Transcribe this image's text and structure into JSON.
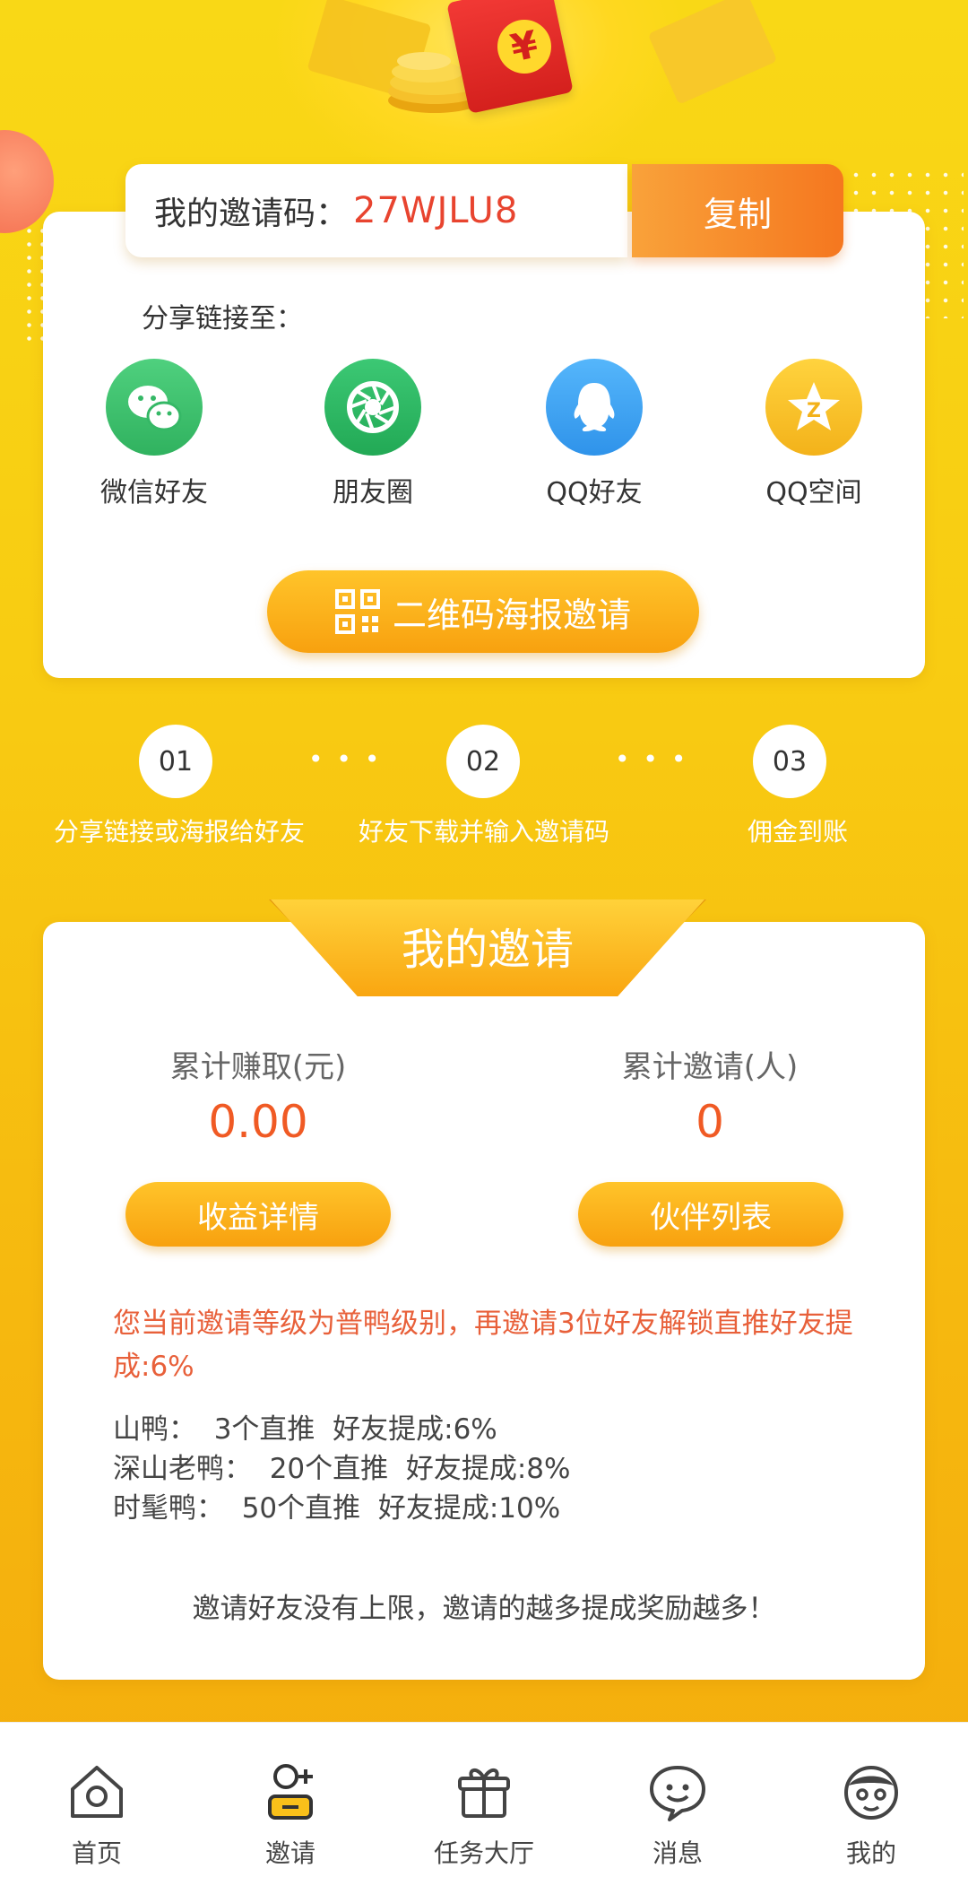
{
  "invite": {
    "code_label": "我的邀请码：",
    "code_value": "27WJLU8",
    "copy_label": "复制"
  },
  "share": {
    "title": "分享链接至：",
    "items": [
      {
        "label": "微信好友",
        "icon": "wechat-icon",
        "color": "#3ec06f"
      },
      {
        "label": "朋友圈",
        "icon": "moments-icon",
        "color": "#2dbb63"
      },
      {
        "label": "QQ好友",
        "icon": "qq-icon",
        "color": "#3aa3f5"
      },
      {
        "label": "QQ空间",
        "icon": "qzone-icon",
        "color": "#f9c22a"
      }
    ],
    "qr_button_label": "二维码海报邀请"
  },
  "steps": [
    {
      "num": "01",
      "text": "分享链接或海报给好友"
    },
    {
      "num": "02",
      "text": "好友下载并输入邀请码"
    },
    {
      "num": "03",
      "text": "佣金到账"
    }
  ],
  "my_invite": {
    "title": "我的邀请",
    "earned_label": "累计赚取(元)",
    "earned_value": "0.00",
    "invited_label": "累计邀请(人)",
    "invited_value": "0",
    "earnings_button": "收益详情",
    "partners_button": "伙伴列表",
    "notice": "您当前邀请等级为普鸭级别，再邀请3位好友解锁直推好友提成:6%",
    "levels": [
      "山鸭：  3个直推  好友提成:6%",
      "深山老鸭：  20个直推  好友提成:8%",
      "时髦鸭：  50个直推  好友提成:10%"
    ],
    "footer": "邀请好友没有上限，邀请的越多提成奖励越多！"
  },
  "nav": [
    {
      "label": "首页",
      "icon": "home-icon"
    },
    {
      "label": "邀请",
      "icon": "invite-icon",
      "active": true
    },
    {
      "label": "任务大厅",
      "icon": "gift-icon"
    },
    {
      "label": "消息",
      "icon": "message-icon"
    },
    {
      "label": "我的",
      "icon": "profile-icon"
    }
  ],
  "colors": {
    "accent_orange": "#f5771f",
    "value_red": "#e8442f",
    "bg_yellow": "#f9d816",
    "active_nav_yellow": "#f9c01a"
  }
}
